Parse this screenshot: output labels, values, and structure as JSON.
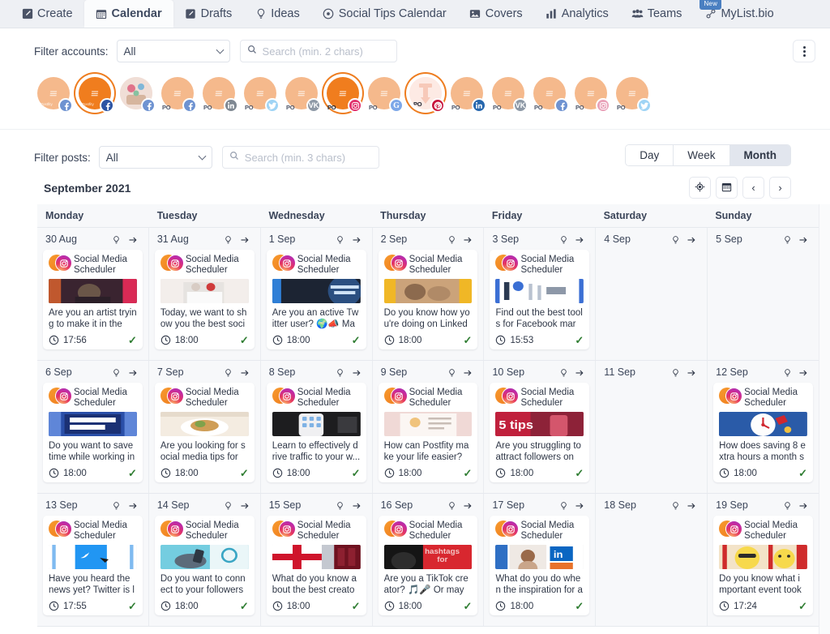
{
  "nav": {
    "tabs": [
      {
        "label": "Create",
        "icon": "pencil-square-icon",
        "active": false,
        "badge": null
      },
      {
        "label": "Calendar",
        "icon": "calendar-icon",
        "active": true,
        "badge": null
      },
      {
        "label": "Drafts",
        "icon": "draft-note-icon",
        "active": false,
        "badge": null
      },
      {
        "label": "Ideas",
        "icon": "lightbulb-icon",
        "active": false,
        "badge": null
      },
      {
        "label": "Social Tips Calendar",
        "icon": "compass-icon",
        "active": false,
        "badge": null
      },
      {
        "label": "Covers",
        "icon": "image-icon",
        "active": false,
        "badge": null
      },
      {
        "label": "Analytics",
        "icon": "bar-chart-icon",
        "active": false,
        "badge": null
      },
      {
        "label": "Teams",
        "icon": "people-icon",
        "active": false,
        "badge": null
      },
      {
        "label": "MyList.bio",
        "icon": "link-icon",
        "active": false,
        "badge": "New"
      }
    ]
  },
  "accounts_filter": {
    "label": "Filter accounts:",
    "select_value": "All",
    "search_placeholder": "Search (min. 2 chars)",
    "search_value": "",
    "kebab_label": "more-options"
  },
  "accounts": [
    {
      "name": "Postfity",
      "network": "facebook",
      "selected": false,
      "style": "logo"
    },
    {
      "name": "Postfity",
      "network": "facebook",
      "selected": true,
      "style": "logo"
    },
    {
      "name": "Postfity",
      "network": "facebook",
      "selected": false,
      "style": "photo"
    },
    {
      "name": "PO",
      "network": "facebook",
      "selected": false,
      "style": "po"
    },
    {
      "name": "PO",
      "network": "linkedin",
      "selected": false,
      "style": "po"
    },
    {
      "name": "PO",
      "network": "twitter",
      "selected": false,
      "style": "po"
    },
    {
      "name": "PO",
      "network": "vk",
      "selected": false,
      "style": "po"
    },
    {
      "name": "PO",
      "network": "instagram",
      "selected": true,
      "style": "po"
    },
    {
      "name": "PO",
      "network": "google",
      "selected": false,
      "style": "po"
    },
    {
      "name": "PO",
      "network": "pinterest",
      "selected": true,
      "style": "pin"
    },
    {
      "name": "PO",
      "network": "linkedin",
      "selected": false,
      "style": "po"
    },
    {
      "name": "PO",
      "network": "vk",
      "selected": false,
      "style": "po"
    },
    {
      "name": "PO",
      "network": "facebook",
      "selected": false,
      "style": "po"
    },
    {
      "name": "PO",
      "network": "instagram",
      "selected": false,
      "style": "po"
    },
    {
      "name": "PO",
      "network": "twitter",
      "selected": false,
      "style": "po"
    }
  ],
  "posts_filter": {
    "label": "Filter posts:",
    "select_value": "All",
    "search_placeholder": "Search (min. 3 chars)",
    "search_value": ""
  },
  "view_toggle": {
    "options": [
      "Day",
      "Week",
      "Month"
    ],
    "selected": "Month"
  },
  "month": {
    "title": "September 2021",
    "today_icon": "target-icon",
    "datepicker_icon": "calendar-icon",
    "prev_label": "‹",
    "next_label": "›"
  },
  "calendar": {
    "day_names": [
      "Monday",
      "Tuesday",
      "Wednesday",
      "Thursday",
      "Friday",
      "Saturday",
      "Sunday"
    ],
    "day_header_icons": [
      "lightbulb-icon",
      "arrow-right-icon"
    ],
    "weeks": [
      [
        {
          "date": "30 Aug",
          "posts": [
            {
              "account": "Social Media Scheduler",
              "network": "instagram",
              "excerpt": "Are you an artist trying to make it in the w...",
              "time": "17:56",
              "status": "published",
              "thumb": "art-dark"
            }
          ]
        },
        {
          "date": "31 Aug",
          "posts": [
            {
              "account": "Social Media Scheduler",
              "network": "instagram",
              "excerpt": "Today, we want to show you the best socia...",
              "time": "18:00",
              "status": "published",
              "thumb": "people-white"
            }
          ]
        },
        {
          "date": "1 Sep",
          "posts": [
            {
              "account": "Social Media Scheduler",
              "network": "instagram",
              "excerpt": "Are you an active Twitter user? 🌍📣 May...",
              "time": "18:00",
              "status": "published",
              "thumb": "engagement-dark"
            }
          ]
        },
        {
          "date": "2 Sep",
          "posts": [
            {
              "account": "Social Media Scheduler",
              "network": "instagram",
              "excerpt": "Do you know how you're doing on Linkedi...",
              "time": "18:00",
              "status": "published",
              "thumb": "yellow-hands"
            }
          ]
        },
        {
          "date": "3 Sep",
          "posts": [
            {
              "account": "Social Media Scheduler",
              "network": "instagram",
              "excerpt": "Find out the best tools for Facebook mark...",
              "time": "15:53",
              "status": "published",
              "thumb": "blue-tools"
            }
          ]
        },
        {
          "date": "4 Sep",
          "posts": []
        },
        {
          "date": "5 Sep",
          "posts": []
        }
      ],
      [
        {
          "date": "6 Sep",
          "posts": [
            {
              "account": "Social Media Scheduler",
              "network": "instagram",
              "excerpt": "Do you want to save time while working in ...",
              "time": "18:00",
              "status": "published",
              "thumb": "schedule-blue"
            }
          ]
        },
        {
          "date": "7 Sep",
          "posts": [
            {
              "account": "Social Media Scheduler",
              "network": "instagram",
              "excerpt": "Are you looking for social media tips for y...",
              "time": "18:00",
              "status": "published",
              "thumb": "food-plate"
            }
          ]
        },
        {
          "date": "8 Sep",
          "posts": [
            {
              "account": "Social Media Scheduler",
              "network": "instagram",
              "excerpt": "Learn to effectively drive traffic to your w...",
              "time": "18:00",
              "status": "published",
              "thumb": "phone-hand"
            }
          ]
        },
        {
          "date": "9 Sep",
          "posts": [
            {
              "account": "Social Media Scheduler",
              "network": "instagram",
              "excerpt": "How can Postfity make your life easier? ...",
              "time": "18:00",
              "status": "published",
              "thumb": "pink-doc"
            }
          ]
        },
        {
          "date": "10 Sep",
          "posts": [
            {
              "account": "Social Media Scheduler",
              "network": "instagram",
              "excerpt": "Are you struggling to attract followers on ...",
              "time": "18:00",
              "status": "published",
              "thumb": "5tips-red"
            }
          ]
        },
        {
          "date": "11 Sep",
          "posts": []
        },
        {
          "date": "12 Sep",
          "posts": [
            {
              "account": "Social Media Scheduler",
              "network": "instagram",
              "excerpt": "How does saving 8 extra hours a month so...",
              "time": "18:00",
              "status": "published",
              "thumb": "clock-blue"
            }
          ]
        }
      ],
      [
        {
          "date": "13 Sep",
          "posts": [
            {
              "account": "Social Media Scheduler",
              "network": "instagram",
              "excerpt": "Have you heard the news yet? Twitter is la...",
              "time": "17:55",
              "status": "published",
              "thumb": "twitter-white"
            }
          ]
        },
        {
          "date": "14 Sep",
          "posts": [
            {
              "account": "Social Media Scheduler",
              "network": "instagram",
              "excerpt": "Do you want to connect to your followers ...",
              "time": "18:00",
              "status": "published",
              "thumb": "phone-teal"
            }
          ]
        },
        {
          "date": "15 Sep",
          "posts": [
            {
              "account": "Social Media Scheduler",
              "network": "instagram",
              "excerpt": "What do you know about the best creator...",
              "time": "18:00",
              "status": "published",
              "thumb": "uk-flag"
            }
          ]
        },
        {
          "date": "16 Sep",
          "posts": [
            {
              "account": "Social Media Scheduler",
              "network": "instagram",
              "excerpt": "Are you a TikTok creator? 🎵🎤 Or mayb...",
              "time": "18:00",
              "status": "published",
              "thumb": "hashtags-red"
            }
          ]
        },
        {
          "date": "17 Sep",
          "posts": [
            {
              "account": "Social Media Scheduler",
              "network": "instagram",
              "excerpt": "What do you do when the inspiration for a ...",
              "time": "18:00",
              "status": "published",
              "thumb": "linkedin-portrait"
            }
          ]
        },
        {
          "date": "18 Sep",
          "posts": []
        },
        {
          "date": "19 Sep",
          "posts": [
            {
              "account": "Social Media Scheduler",
              "network": "instagram",
              "excerpt": "Do you know what important event took ...",
              "time": "17:24",
              "status": "published",
              "thumb": "emoji-yellow"
            }
          ]
        }
      ]
    ]
  },
  "colors": {
    "brand_orange": "#ee7d20",
    "accent_blue": "#4a7fc1",
    "status_green": "#2f7d32",
    "page_bg": "#eef0f4",
    "cell_bg": "#f7f8fa"
  }
}
